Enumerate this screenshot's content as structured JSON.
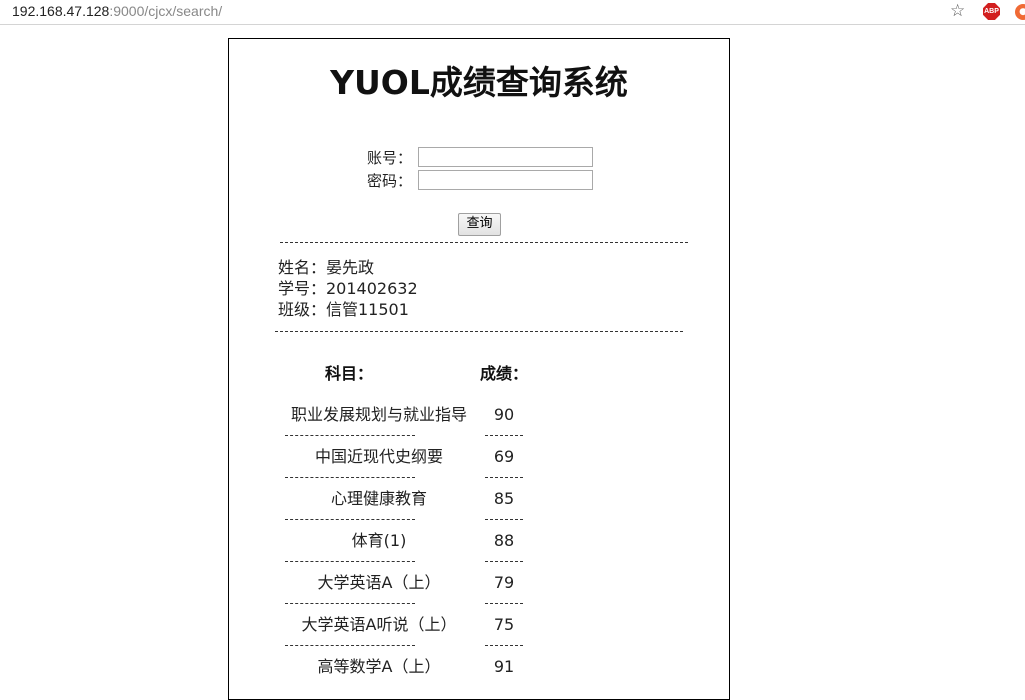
{
  "browser": {
    "url_host": "192.168.47.128",
    "url_rest": ":9000/cjcx/search/"
  },
  "page": {
    "title": "YUOL成绩查询系统",
    "account_label": "账号：",
    "password_label": "密码：",
    "account_value": "",
    "password_value": "",
    "query_button": "查询"
  },
  "student": {
    "name": "姓名：晏先政",
    "id": "学号：201402632",
    "class": "班级：信管11501"
  },
  "table": {
    "subject_header": "科目：",
    "score_header": "成绩：",
    "rows": [
      {
        "subject": "职业发展规划与就业指导",
        "score": "90"
      },
      {
        "subject": "中国近现代史纲要",
        "score": "69"
      },
      {
        "subject": "心理健康教育",
        "score": "85"
      },
      {
        "subject": "体育(1)",
        "score": "88"
      },
      {
        "subject": "大学英语A（上）",
        "score": "79"
      },
      {
        "subject": "大学英语A听说（上）",
        "score": "75"
      },
      {
        "subject": "高等数学A（上）",
        "score": "91"
      }
    ]
  }
}
